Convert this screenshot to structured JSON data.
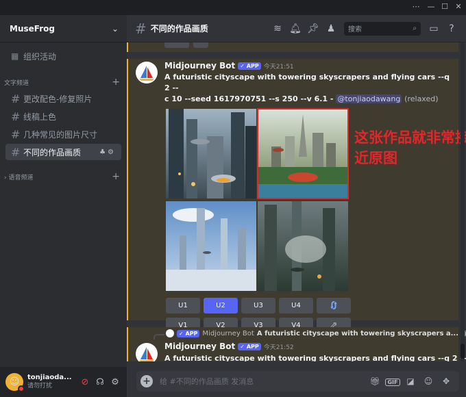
{
  "window": {
    "controls": [
      "⋯",
      "—",
      "☐",
      "✕"
    ]
  },
  "sidebar": {
    "server_name": "MuseFrog",
    "events_label": "组织活动",
    "text_category": "文字频道",
    "voice_category": "语音频道",
    "channels": [
      {
        "label": "更改配色-修复照片"
      },
      {
        "label": "线稿上色"
      },
      {
        "label": "几种常见的图片尺寸"
      },
      {
        "label": "不同的作品画质"
      }
    ]
  },
  "user": {
    "name": "tonjiaoda...",
    "status": "请勿打扰"
  },
  "header": {
    "channel_name": "不同的作品画质",
    "search_placeholder": "搜索"
  },
  "message1": {
    "author": "Midjourney Bot",
    "badge": "APP",
    "timestamp": "今天21:51",
    "prompt_line1": "A futuristic cityscape with towering skyscrapers and flying cars --q 2 --",
    "prompt_line2": "c 10 --seed 1617970751 --s 250 --v 6.1 - ",
    "mention": "@tonjiaodawang",
    "mode": "(relaxed)",
    "upscale_buttons": [
      "U1",
      "U2",
      "U3",
      "U4"
    ],
    "variation_buttons": [
      "V1",
      "V2",
      "V3",
      "V4"
    ],
    "selected_button": "U2"
  },
  "annotation": {
    "text": "这张作品就非常接近原图"
  },
  "message2": {
    "reply_author": "Midjourney Bot",
    "reply_badge": "APP",
    "reply_text": "A futuristic cityscape with towering skyscrapers a...",
    "author": "Midjourney Bot",
    "badge": "APP",
    "timestamp": "今天21:52",
    "prompt_line1": "A futuristic cityscape with towering skyscrapers and flying cars --q 2 --"
  },
  "composer": {
    "placeholder": "给 #不同的作品画质 发消息",
    "gif_label": "GIF"
  },
  "colors": {
    "accent": "#5865f2",
    "highlight_border": "#f0b232",
    "annotation_red": "#e3262b"
  }
}
